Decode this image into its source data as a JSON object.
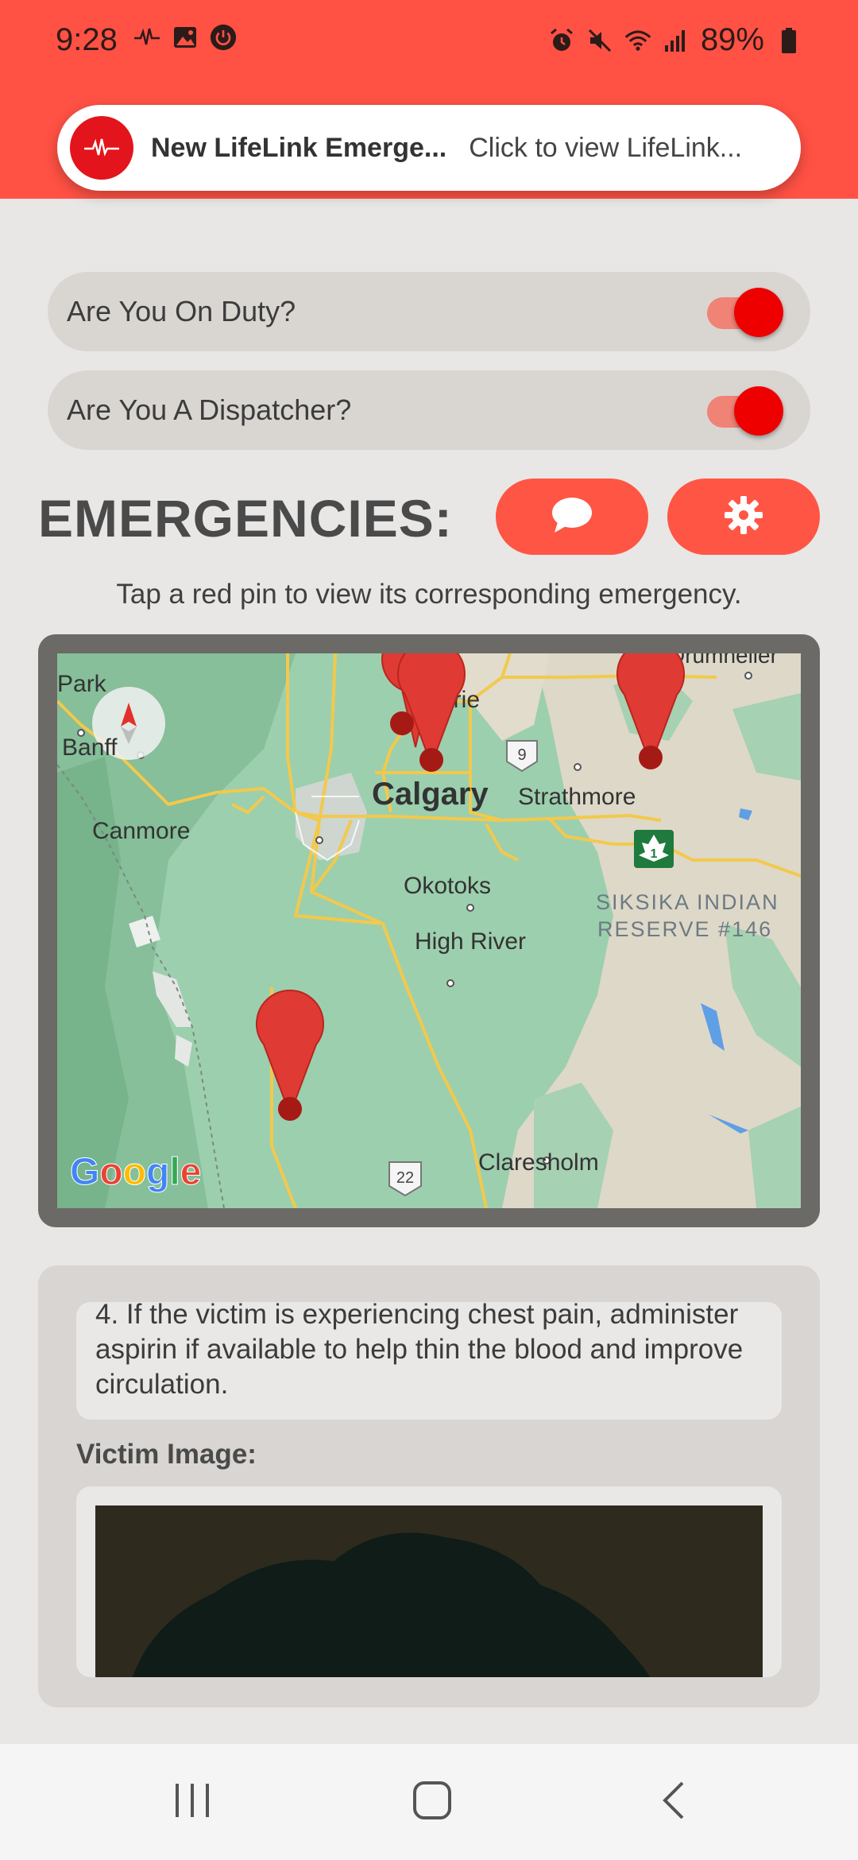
{
  "status": {
    "time": "9:28",
    "battery": "89%"
  },
  "notification": {
    "title": "New LifeLink Emerge...",
    "text": "Click to view LifeLink..."
  },
  "toggles": [
    {
      "label": "Are You On Duty?",
      "on": true
    },
    {
      "label": "Are You A Dispatcher?",
      "on": true
    }
  ],
  "emergencies": {
    "title": "EMERGENCIES:",
    "hint": "Tap a red pin to view its corresponding emergency.",
    "chat_icon": "chat-bubble-icon",
    "settings_icon": "gear-icon"
  },
  "map": {
    "labels": {
      "park": "Park",
      "banff": "Banff",
      "canmore": "Canmore",
      "airdrie": "rdrie",
      "calgary": "Calgary",
      "strathmore": "Strathmore",
      "drumheller": "Drumheller",
      "okotoks": "Okotoks",
      "high_river": "High River",
      "siksika_1": "SIKSIKA INDIAN",
      "siksika_2": "RESERVE #146",
      "claresholm": "Claresholm",
      "hwy9": "9",
      "hwy22": "22",
      "hwy1": "1"
    },
    "attribution": "Google",
    "pin_color": "#d93025"
  },
  "details": {
    "instruction": "4. If the victim is experiencing chest pain, administer aspirin if available to help thin the blood and improve circulation.",
    "victim_image_label": "Victim Image:"
  },
  "colors": {
    "accent": "#ff5144",
    "toggle_on": "#ee0000"
  }
}
